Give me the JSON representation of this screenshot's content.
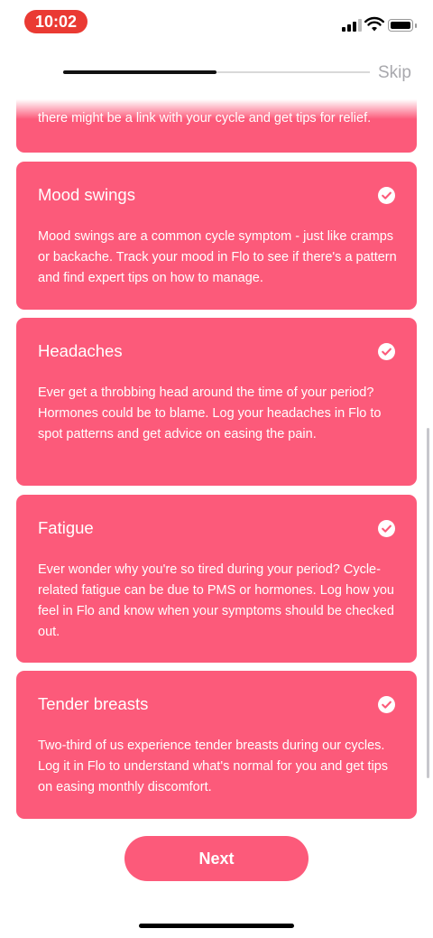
{
  "status_bar": {
    "time": "10:02"
  },
  "header": {
    "skip_label": "Skip",
    "progress": 0.5
  },
  "cards": [
    {
      "title": "",
      "body": "there might be a link with your cycle and get tips for relief.",
      "checked": true
    },
    {
      "title": "Mood swings",
      "body": "Mood swings are a common cycle symptom - just like cramps or backache. Track your mood in Flo to see if there's a pattern and find expert tips on how to manage.",
      "checked": true
    },
    {
      "title": "Headaches",
      "body": "Ever get a throbbing head around the time of your period? Hormones could be to blame. Log your headaches in Flo to spot patterns and get advice on easing the pain.",
      "checked": true
    },
    {
      "title": "Fatigue",
      "body": "Ever wonder why you're so tired during your period? Cycle-related fatigue can be due to PMS or hormones. Log how you feel in Flo and know when your symptoms should be checked out.",
      "checked": true
    },
    {
      "title": "Tender breasts",
      "body": "Two-third of us experience tender breasts during our cycles. Log it in Flo to understand what's normal for you and get tips on easing monthly discomfort.",
      "checked": true
    }
  ],
  "footer": {
    "next_label": "Next"
  },
  "colors": {
    "accent": "#fc5a7a",
    "time_pill": "#ea3a33"
  }
}
